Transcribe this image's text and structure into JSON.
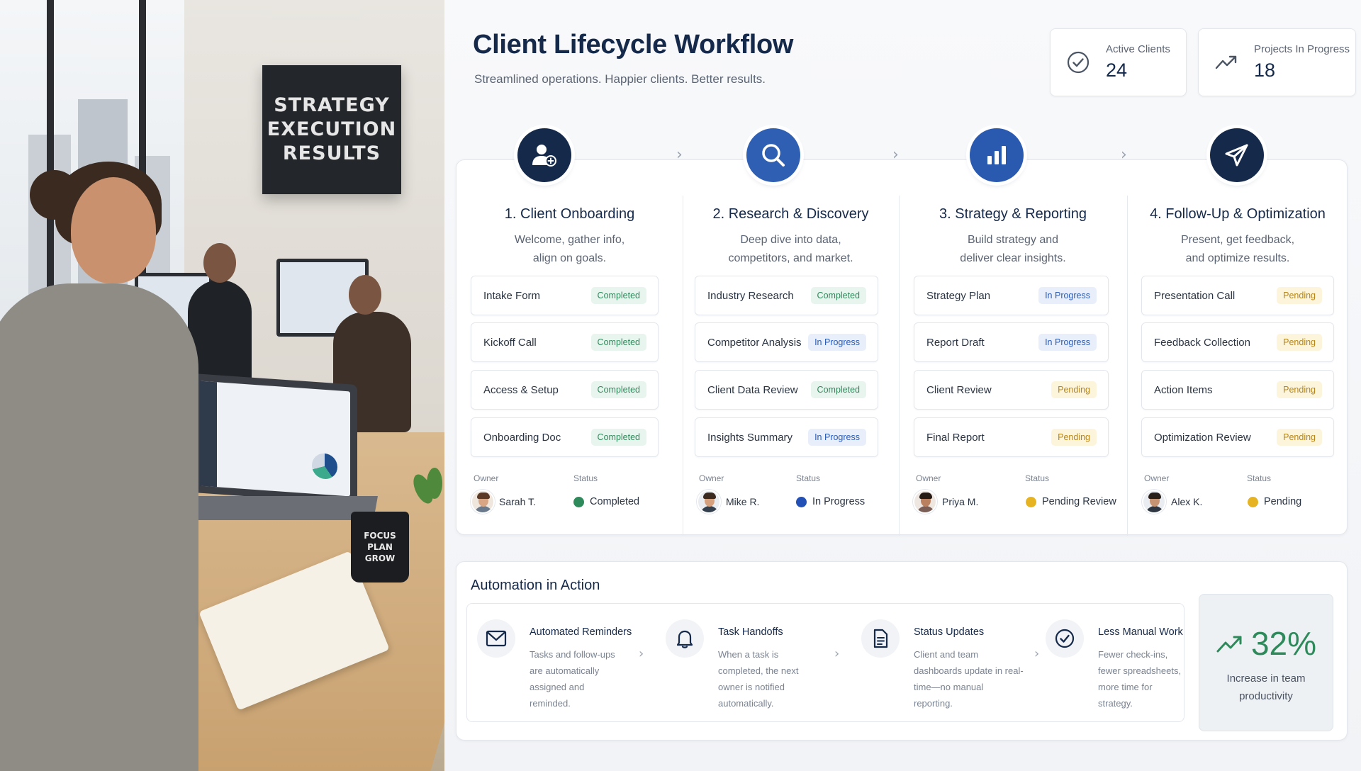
{
  "photo": {
    "wall_sign": "STRATEGY\nEXECUTION\nRESULTS",
    "mug_text": "FOCUS\nPLAN\nGROW"
  },
  "header": {
    "title": "Client Lifecycle Workflow",
    "subtitle": "Streamlined operations. Happier clients. Better results."
  },
  "kpis": [
    {
      "label": "Active Clients",
      "value": "24",
      "icon": "check-circle-icon"
    },
    {
      "label": "Projects In Progress",
      "value": "18",
      "icon": "trend-up-icon"
    }
  ],
  "stages": [
    {
      "title": "1. Client Onboarding",
      "desc1": "Welcome, gather info,",
      "desc2": "align on goals.",
      "icon": "add-user-icon",
      "color": "#15294a",
      "tasks": [
        {
          "name": "Intake Form",
          "status": "Completed"
        },
        {
          "name": "Kickoff Call",
          "status": "Completed"
        },
        {
          "name": "Access & Setup",
          "status": "Completed"
        },
        {
          "name": "Onboarding Doc",
          "status": "Completed"
        }
      ],
      "owner_label": "Owner",
      "status_label": "Status",
      "owner": "Sarah T.",
      "state": "Completed",
      "state_color": "#2f8a5b"
    },
    {
      "title": "2. Research & Discovery",
      "desc1": "Deep dive into data,",
      "desc2": "competitors, and market.",
      "icon": "search-icon",
      "color": "#2f5fb3",
      "tasks": [
        {
          "name": "Industry Research",
          "status": "Completed"
        },
        {
          "name": "Competitor Analysis",
          "status": "In Progress"
        },
        {
          "name": "Client Data Review",
          "status": "Completed"
        },
        {
          "name": "Insights Summary",
          "status": "In Progress"
        }
      ],
      "owner_label": "Owner",
      "status_label": "Status",
      "owner": "Mike R.",
      "state": "In Progress",
      "state_color": "#2350b5"
    },
    {
      "title": "3. Strategy & Reporting",
      "desc1": "Build strategy and",
      "desc2": "deliver clear insights.",
      "icon": "bar-chart-icon",
      "color": "#2a5ab0",
      "tasks": [
        {
          "name": "Strategy Plan",
          "status": "In Progress"
        },
        {
          "name": "Report Draft",
          "status": "In Progress"
        },
        {
          "name": "Client Review",
          "status": "Pending"
        },
        {
          "name": "Final Report",
          "status": "Pending"
        }
      ],
      "owner_label": "Owner",
      "status_label": "Status",
      "owner": "Priya M.",
      "state": "Pending Review",
      "state_color": "#e6b422"
    },
    {
      "title": "4. Follow-Up & Optimization",
      "desc1": "Present, get feedback,",
      "desc2": "and optimize results.",
      "icon": "paper-plane-icon",
      "color": "#15294a",
      "tasks": [
        {
          "name": "Presentation Call",
          "status": "Pending"
        },
        {
          "name": "Feedback Collection",
          "status": "Pending"
        },
        {
          "name": "Action Items",
          "status": "Pending"
        },
        {
          "name": "Optimization Review",
          "status": "Pending"
        }
      ],
      "owner_label": "Owner",
      "status_label": "Status",
      "owner": "Alex K.",
      "state": "Pending",
      "state_color": "#e6b422"
    }
  ],
  "automation": {
    "title": "Automation in Action",
    "features": [
      {
        "title": "Automated Reminders",
        "desc": "Tasks and follow-ups are automatically assigned and reminded.",
        "icon": "mail-icon"
      },
      {
        "title": "Task Handoffs",
        "desc": "When a task is completed, the next owner is notified automatically.",
        "icon": "bell-icon"
      },
      {
        "title": "Status Updates",
        "desc": "Client and team dashboards update in real-time—no manual reporting.",
        "icon": "document-icon"
      },
      {
        "title": "Less Manual Work",
        "desc": "Fewer check-ins, fewer spreadsheets, more time for strategy.",
        "icon": "check-circle-icon"
      }
    ],
    "result": {
      "value": "32%",
      "caption1": "Increase in team",
      "caption2": "productivity",
      "icon": "trend-up-icon",
      "color": "#2f8a5b"
    }
  }
}
